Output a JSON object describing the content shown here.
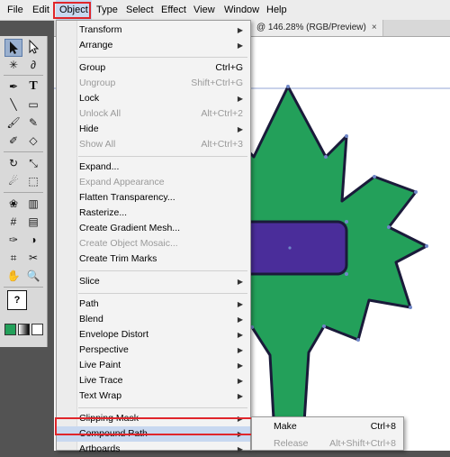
{
  "colors": {
    "leaf_fill": "#23a05a",
    "bar_fill": "#4a2d9a",
    "outline": "#1a1a3a",
    "highlight_box": "#e0262b",
    "menu_hover": "#c8d8f0"
  },
  "menubar": {
    "items": [
      "File",
      "Edit",
      "Object",
      "Type",
      "Select",
      "Effect",
      "View",
      "Window",
      "Help"
    ],
    "active": "Object"
  },
  "document_tab": {
    "label": "@ 146.28% (RGB/Preview)",
    "close_glyph": "×"
  },
  "toolbox": {
    "tools": [
      "selection-tool",
      "direct-selection-tool",
      "magic-wand-tool",
      "lasso-tool",
      "pen-tool",
      "type-tool",
      "line-tool",
      "rectangle-tool",
      "paintbrush-tool",
      "pencil-tool",
      "blob-brush-tool",
      "eraser-tool",
      "rotate-tool",
      "scale-tool",
      "warp-tool",
      "free-transform-tool",
      "symbol-sprayer-tool",
      "graph-tool",
      "mesh-tool",
      "gradient-tool",
      "eyedropper-tool",
      "blend-tool",
      "slice-tool",
      "scissors-tool",
      "hand-tool",
      "zoom-tool"
    ],
    "fill_stroke_label": "?"
  },
  "object_menu": {
    "items": [
      {
        "label": "Transform",
        "shortcut": "",
        "submenu": true,
        "disabled": false
      },
      {
        "label": "Arrange",
        "shortcut": "",
        "submenu": true,
        "disabled": false
      },
      {
        "separator": true
      },
      {
        "label": "Group",
        "shortcut": "Ctrl+G",
        "submenu": false,
        "disabled": false
      },
      {
        "label": "Ungroup",
        "shortcut": "Shift+Ctrl+G",
        "submenu": false,
        "disabled": true
      },
      {
        "label": "Lock",
        "shortcut": "",
        "submenu": true,
        "disabled": false
      },
      {
        "label": "Unlock All",
        "shortcut": "Alt+Ctrl+2",
        "submenu": false,
        "disabled": true
      },
      {
        "label": "Hide",
        "shortcut": "",
        "submenu": true,
        "disabled": false
      },
      {
        "label": "Show All",
        "shortcut": "Alt+Ctrl+3",
        "submenu": false,
        "disabled": true
      },
      {
        "separator": true
      },
      {
        "label": "Expand...",
        "shortcut": "",
        "submenu": false,
        "disabled": false
      },
      {
        "label": "Expand Appearance",
        "shortcut": "",
        "submenu": false,
        "disabled": true
      },
      {
        "label": "Flatten Transparency...",
        "shortcut": "",
        "submenu": false,
        "disabled": false
      },
      {
        "label": "Rasterize...",
        "shortcut": "",
        "submenu": false,
        "disabled": false
      },
      {
        "label": "Create Gradient Mesh...",
        "shortcut": "",
        "submenu": false,
        "disabled": false
      },
      {
        "label": "Create Object Mosaic...",
        "shortcut": "",
        "submenu": false,
        "disabled": true
      },
      {
        "label": "Create Trim Marks",
        "shortcut": "",
        "submenu": false,
        "disabled": false
      },
      {
        "separator": true
      },
      {
        "label": "Slice",
        "shortcut": "",
        "submenu": true,
        "disabled": false
      },
      {
        "separator": true
      },
      {
        "label": "Path",
        "shortcut": "",
        "submenu": true,
        "disabled": false
      },
      {
        "label": "Blend",
        "shortcut": "",
        "submenu": true,
        "disabled": false
      },
      {
        "label": "Envelope Distort",
        "shortcut": "",
        "submenu": true,
        "disabled": false
      },
      {
        "label": "Perspective",
        "shortcut": "",
        "submenu": true,
        "disabled": false
      },
      {
        "label": "Live Paint",
        "shortcut": "",
        "submenu": true,
        "disabled": false
      },
      {
        "label": "Live Trace",
        "shortcut": "",
        "submenu": true,
        "disabled": false
      },
      {
        "label": "Text Wrap",
        "shortcut": "",
        "submenu": true,
        "disabled": false
      },
      {
        "separator": true
      },
      {
        "label": "Clipping Mask",
        "shortcut": "",
        "submenu": true,
        "disabled": false
      },
      {
        "label": "Compound Path",
        "shortcut": "",
        "submenu": true,
        "disabled": false,
        "active": true
      },
      {
        "label": "Artboards",
        "shortcut": "",
        "submenu": true,
        "disabled": false
      }
    ]
  },
  "compound_path_submenu": {
    "items": [
      {
        "label": "Make",
        "shortcut": "Ctrl+8",
        "disabled": false
      },
      {
        "label": "Release",
        "shortcut": "Alt+Shift+Ctrl+8",
        "disabled": true
      }
    ]
  },
  "submenu_arrow_glyph": "▶"
}
